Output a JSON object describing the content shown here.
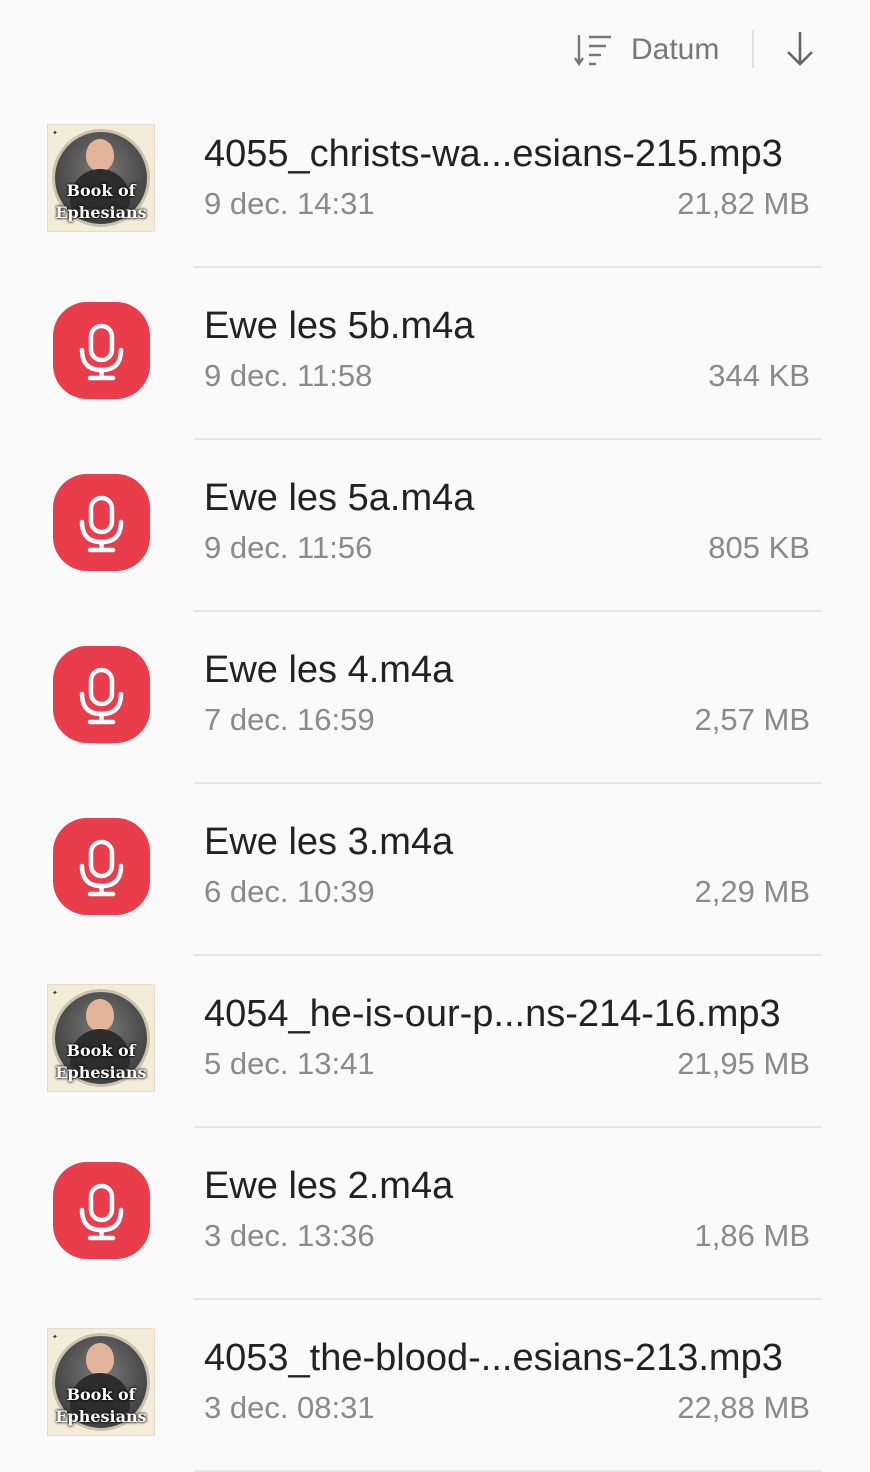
{
  "sort": {
    "label": "Datum",
    "icon": "sort-lines-icon",
    "direction_icon": "arrow-down-icon"
  },
  "colors": {
    "recorder_icon_bg": "#e93d4c",
    "primary_text": "#222222",
    "secondary_text": "#8a8a8a"
  },
  "files": [
    {
      "name": "4055_christs-wa...esians-215.mp3",
      "date": "9 dec. 14:31",
      "size": "21,82 MB",
      "icon": "album-art-icon",
      "art_line1": "Book of",
      "art_line2": "Ephesians"
    },
    {
      "name": "Ewe les 5b.m4a",
      "date": "9 dec. 11:58",
      "size": "344 KB",
      "icon": "voice-recorder-icon"
    },
    {
      "name": "Ewe les 5a.m4a",
      "date": "9 dec. 11:56",
      "size": "805 KB",
      "icon": "voice-recorder-icon"
    },
    {
      "name": "Ewe les 4.m4a",
      "date": "7 dec. 16:59",
      "size": "2,57 MB",
      "icon": "voice-recorder-icon"
    },
    {
      "name": "Ewe les 3.m4a",
      "date": "6 dec. 10:39",
      "size": "2,29 MB",
      "icon": "voice-recorder-icon"
    },
    {
      "name": "4054_he-is-our-p...ns-214-16.mp3",
      "date": "5 dec. 13:41",
      "size": "21,95 MB",
      "icon": "album-art-icon",
      "art_line1": "Book of",
      "art_line2": "Ephesians"
    },
    {
      "name": "Ewe les 2.m4a",
      "date": "3 dec. 13:36",
      "size": "1,86 MB",
      "icon": "voice-recorder-icon"
    },
    {
      "name": "4053_the-blood-...esians-213.mp3",
      "date": "3 dec. 08:31",
      "size": "22,88 MB",
      "icon": "album-art-icon",
      "art_line1": "Book of",
      "art_line2": "Ephesians"
    }
  ]
}
